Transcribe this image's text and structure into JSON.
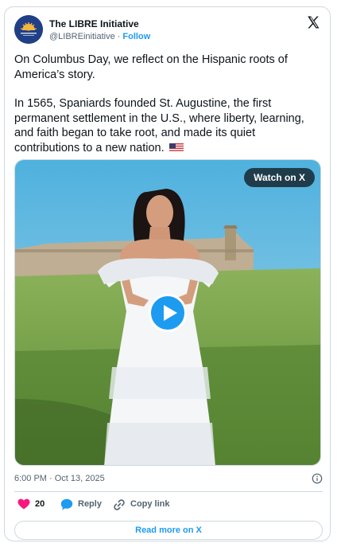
{
  "author": {
    "name": "The LIBRE Initiative",
    "handle": "@LIBREinitiative",
    "follow_label": "Follow",
    "avatar_text": "THE LIBRE INITIATIVE"
  },
  "tweet": {
    "paragraph1": "On Columbus Day, we reflect on the Hispanic roots of America’s story.",
    "paragraph2": "In 1565, Spaniards founded St. Augustine, the first permanent settlement in the U.S., where liberty, learning, and faith began to take root, and made its quiet contributions to a new nation."
  },
  "media": {
    "watch_label": "Watch on X"
  },
  "meta": {
    "timestamp": "6:00 PM · Oct 13, 2025"
  },
  "actions": {
    "like_count": "20",
    "reply_label": "Reply",
    "copy_label": "Copy link"
  },
  "footer": {
    "read_more_label": "Read more on X"
  },
  "colors": {
    "accent": "#1d9bf0",
    "like": "#f91880",
    "text": "#0f1419",
    "secondary": "#536471"
  }
}
